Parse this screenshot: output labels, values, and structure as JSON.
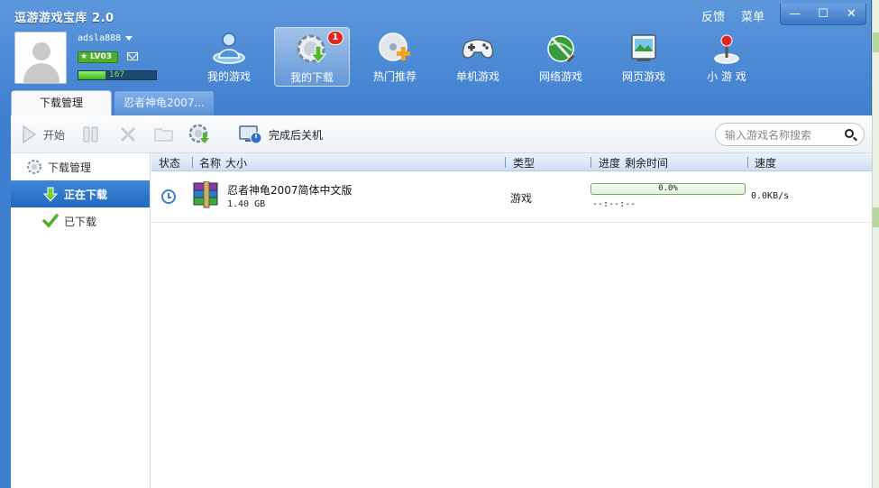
{
  "app": {
    "title": "逗游游戏宝库 2.0"
  },
  "topbar": {
    "feedback": "反馈",
    "menu": "菜单"
  },
  "window_buttons": {
    "minimize": "—",
    "maximize": "☐",
    "close": "✕"
  },
  "user": {
    "username": "adsla888",
    "level": "LV03",
    "exp_value": "167",
    "exp_fraction": 0.35
  },
  "nav": {
    "items": [
      {
        "label": "我的游戏",
        "icon": "person-globe-icon"
      },
      {
        "label": "我的下载",
        "icon": "gear-download-icon",
        "badge": "1"
      },
      {
        "label": "热门推荐",
        "icon": "cd-plus-icon"
      },
      {
        "label": "单机游戏",
        "icon": "gamepad-icon"
      },
      {
        "label": "网络游戏",
        "icon": "globe-sword-icon"
      },
      {
        "label": "网页游戏",
        "icon": "web-monitor-icon"
      },
      {
        "label": "小 游 戏",
        "icon": "joystick-icon"
      }
    ]
  },
  "tabs": [
    {
      "label": "下载管理"
    },
    {
      "label": "忍者神龟2007..."
    }
  ],
  "toolbar": {
    "start_label": "开始",
    "shutdown_label": "完成后关机",
    "search_placeholder": "输入游戏名称搜索"
  },
  "sidebar": {
    "header": "下载管理",
    "items": [
      {
        "label": "正在下载"
      },
      {
        "label": "已下载"
      }
    ]
  },
  "table": {
    "headers": {
      "status": "状态",
      "name": "名称",
      "size": "大小",
      "type": "类型",
      "progress": "进度",
      "remaining": "剩余时间",
      "speed": "速度"
    },
    "rows": [
      {
        "name": "忍者神龟2007简体中文版",
        "size": "1.40 GB",
        "type": "游戏",
        "progress_text": "0.0%",
        "progress": 0.0,
        "remaining": "--:--:--",
        "speed": "0.0KB/s"
      }
    ]
  },
  "colors": {
    "accent": "#3f7fd0",
    "selected": "#2469c0",
    "progress": "#4fae2b"
  }
}
